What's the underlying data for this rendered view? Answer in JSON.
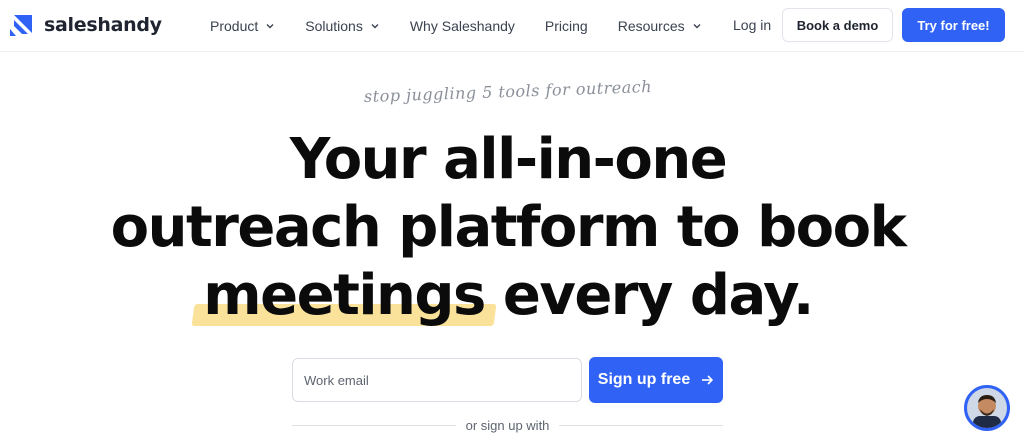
{
  "brand": {
    "name": "saleshandy",
    "accent": "#2f62f5",
    "highlight": "#fbe29a"
  },
  "nav": {
    "items": [
      {
        "label": "Product",
        "has_dropdown": true
      },
      {
        "label": "Solutions",
        "has_dropdown": true
      },
      {
        "label": "Why Saleshandy",
        "has_dropdown": false
      },
      {
        "label": "Pricing",
        "has_dropdown": false
      },
      {
        "label": "Resources",
        "has_dropdown": true
      }
    ],
    "login": "Log in",
    "book_demo": "Book a demo",
    "try_free": "Try for free!"
  },
  "hero": {
    "tagline": "stop juggling 5 tools for outreach",
    "line1": "Your all-in-one",
    "line2": "outreach platform to book",
    "line3_highlight": "meetings",
    "line3_rest": " every day."
  },
  "signup": {
    "email_placeholder": "Work email",
    "button_label": "Sign up free",
    "or_text": "or sign up with"
  },
  "icons": {
    "dropdown": "chevron-down-icon",
    "arrow": "arrow-right-icon",
    "chat": "support-avatar"
  }
}
